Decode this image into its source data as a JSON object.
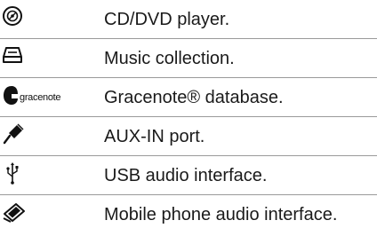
{
  "legend": {
    "items": [
      {
        "icon": "cd-dvd-icon",
        "label": "CD/DVD player."
      },
      {
        "icon": "music-collection-icon",
        "label": "Music collection."
      },
      {
        "icon": "gracenote-logo-icon",
        "brand": "gracenote",
        "label": "Gracenote® database."
      },
      {
        "icon": "aux-in-plug-icon",
        "label": "AUX-IN port."
      },
      {
        "icon": "usb-icon",
        "label": "USB audio interface."
      },
      {
        "icon": "mobile-phone-audio-icon",
        "label": "Mobile phone audio interface."
      }
    ]
  },
  "colors": {
    "text": "#1a1a1a",
    "divider": "#9a9a9a",
    "background": "#ffffff"
  }
}
